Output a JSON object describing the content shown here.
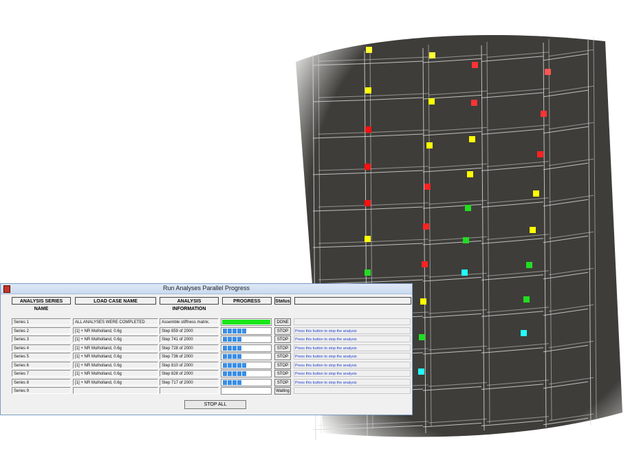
{
  "window": {
    "title": "Run Analyses Parallel Progress"
  },
  "columns": {
    "series": "ANALYSIS SERIES NAME",
    "load_case": "LOAD CASE NAME",
    "info": "ANALYSIS INFORMATION",
    "progress": "PROGRESS",
    "status": "Status"
  },
  "rows": [
    {
      "series": "Series 1",
      "load_case": "ALL ANALYSES WERE COMPLETED",
      "info": "Assemble stiffness matrix.",
      "progress": 1.0,
      "button": "DONE",
      "hint": ""
    },
    {
      "series": "Series 2",
      "load_case": "[1] + NR Mulholland, 0.6g",
      "info": "Step 859 of 2000",
      "progress": 0.43,
      "button": "STOP",
      "hint": "Press this button to stop the analysis"
    },
    {
      "series": "Series 3",
      "load_case": "[1] + NR Mulholland, 0.6g",
      "info": "Step 741 of 2000",
      "progress": 0.37,
      "button": "STOP",
      "hint": "Press this button to stop the analysis"
    },
    {
      "series": "Series 4",
      "load_case": "[1] + NR Mulholland, 0.6g",
      "info": "Step 728 of 2000",
      "progress": 0.36,
      "button": "STOP",
      "hint": "Press this button to stop the analysis"
    },
    {
      "series": "Series 5",
      "load_case": "[1] + NR Mulholland, 0.6g",
      "info": "Step 736 of 2000",
      "progress": 0.37,
      "button": "STOP",
      "hint": "Press this button to stop the analysis"
    },
    {
      "series": "Series 6",
      "load_case": "[1] + NR Mulholland, 0.6g",
      "info": "Step 810 of 2000",
      "progress": 0.41,
      "button": "STOP",
      "hint": "Press this button to stop the analysis"
    },
    {
      "series": "Series 7",
      "load_case": "[1] + NR Mulholland, 0.6g",
      "info": "Step 828 of 2000",
      "progress": 0.41,
      "button": "STOP",
      "hint": "Press this button to stop the analysis"
    },
    {
      "series": "Series 8",
      "load_case": "[1] + NR Mulholland, 0.6g",
      "info": "Step 717 of 2000",
      "progress": 0.36,
      "button": "STOP",
      "hint": "Press this button to stop the analysis"
    },
    {
      "series": "Series 9",
      "load_case": "",
      "info": "",
      "progress": 0,
      "button": "Waiting",
      "hint": ""
    }
  ],
  "footer": {
    "stop_all": "STOP ALL"
  },
  "colors": {
    "progress_segment": "#3a8ee6",
    "progress_complete": "#19e619",
    "hint_text": "#1a3cd0",
    "background_structure": "#3e3d39"
  },
  "icons": {
    "app": "app-icon"
  }
}
